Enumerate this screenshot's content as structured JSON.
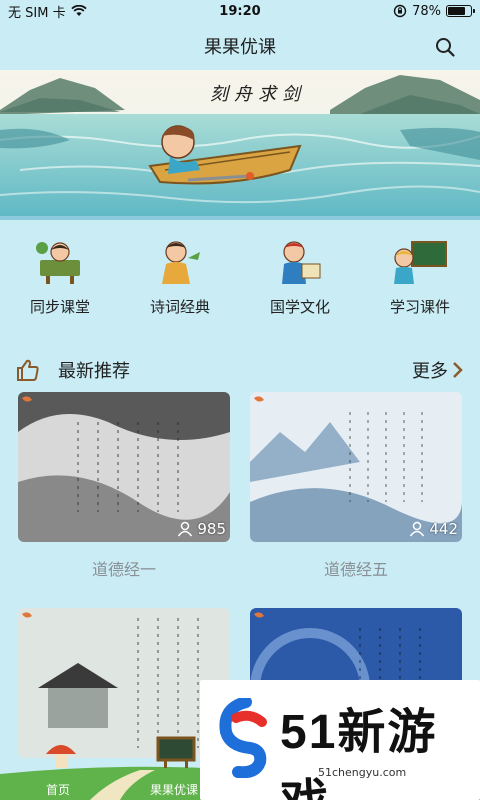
{
  "status": {
    "carrier": "无 SIM 卡",
    "time": "19:20",
    "battery_text": "78%",
    "battery_level": 0.78
  },
  "nav": {
    "title": "果果优课"
  },
  "banner": {
    "title": "刻舟求剑"
  },
  "categories": [
    {
      "label": "同步课堂"
    },
    {
      "label": "诗词经典"
    },
    {
      "label": "国学文化"
    },
    {
      "label": "学习课件"
    }
  ],
  "section": {
    "title": "最新推荐",
    "more": "更多"
  },
  "cards": [
    {
      "title": "道德经一",
      "views": "985",
      "thumb_text": "道德经"
    },
    {
      "title": "道德经五",
      "views": "442",
      "thumb_text": "道德经"
    },
    {
      "title": "",
      "views": "",
      "thumb_text": ""
    },
    {
      "title": "",
      "views": "",
      "thumb_text": "道德"
    }
  ],
  "tabbar": {
    "home": "首页",
    "courses": "果果优课"
  },
  "watermark": {
    "brand": "51新游戏",
    "url": "51chengyu.com"
  },
  "colors": {
    "page_bg": "#c9ecf5",
    "accent": "#8b5a2b",
    "brand_blue": "#1e6fd9",
    "brand_red": "#e8302b"
  }
}
